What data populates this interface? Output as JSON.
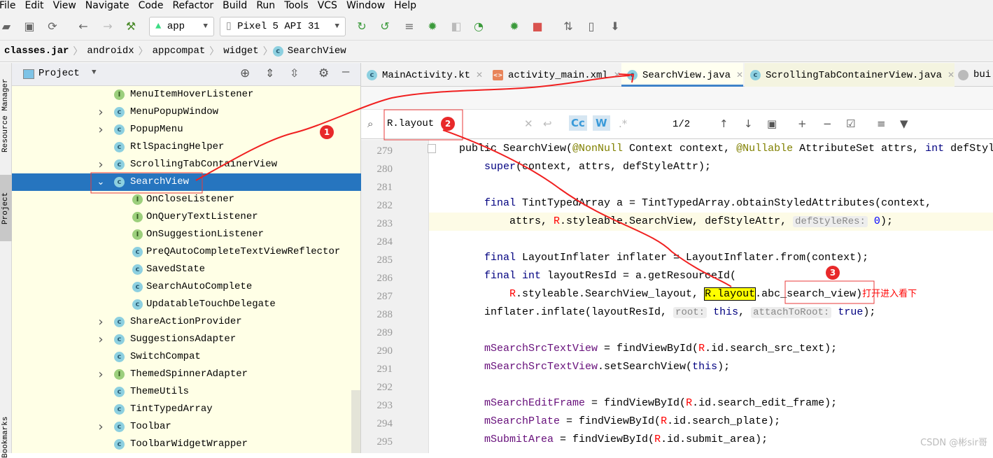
{
  "menu": [
    "File",
    "Edit",
    "View",
    "Navigate",
    "Code",
    "Refactor",
    "Build",
    "Run",
    "Tools",
    "VCS",
    "Window",
    "Help"
  ],
  "toolbar": {
    "config": "app",
    "device": "Pixel 5 API 31"
  },
  "breadcrumb": [
    "classes.jar",
    "androidx",
    "appcompat",
    "widget",
    "SearchView"
  ],
  "side_tabs": [
    "Resource Manager",
    "Project",
    "Bookmarks"
  ],
  "project": {
    "title": "Project",
    "tree": [
      {
        "label": "MenuItemHoverListener",
        "kind": "I",
        "level": 0,
        "chevron": ""
      },
      {
        "label": "MenuPopupWindow",
        "kind": "C",
        "level": 0,
        "chevron": "›"
      },
      {
        "label": "PopupMenu",
        "kind": "C",
        "level": 0,
        "chevron": "›"
      },
      {
        "label": "RtlSpacingHelper",
        "kind": "C",
        "level": 0,
        "chevron": ""
      },
      {
        "label": "ScrollingTabContainerView",
        "kind": "C",
        "level": 0,
        "chevron": "›"
      },
      {
        "label": "SearchView",
        "kind": "C",
        "level": 0,
        "chevron": "⌄",
        "selected": true
      },
      {
        "label": "OnCloseListener",
        "kind": "I",
        "level": 1,
        "chevron": ""
      },
      {
        "label": "OnQueryTextListener",
        "kind": "I",
        "level": 1,
        "chevron": ""
      },
      {
        "label": "OnSuggestionListener",
        "kind": "I",
        "level": 1,
        "chevron": ""
      },
      {
        "label": "PreQAutoCompleteTextViewReflector",
        "kind": "C",
        "level": 1,
        "chevron": ""
      },
      {
        "label": "SavedState",
        "kind": "C",
        "level": 1,
        "chevron": ""
      },
      {
        "label": "SearchAutoComplete",
        "kind": "C",
        "level": 1,
        "chevron": ""
      },
      {
        "label": "UpdatableTouchDelegate",
        "kind": "C",
        "level": 1,
        "chevron": ""
      },
      {
        "label": "ShareActionProvider",
        "kind": "C",
        "level": 0,
        "chevron": "›"
      },
      {
        "label": "SuggestionsAdapter",
        "kind": "C",
        "level": 0,
        "chevron": "›"
      },
      {
        "label": "SwitchCompat",
        "kind": "C",
        "level": 0,
        "chevron": ""
      },
      {
        "label": "ThemedSpinnerAdapter",
        "kind": "I",
        "level": 0,
        "chevron": "›"
      },
      {
        "label": "ThemeUtils",
        "kind": "C",
        "level": 0,
        "chevron": ""
      },
      {
        "label": "TintTypedArray",
        "kind": "C",
        "level": 0,
        "chevron": ""
      },
      {
        "label": "Toolbar",
        "kind": "C",
        "level": 0,
        "chevron": "›"
      },
      {
        "label": "ToolbarWidgetWrapper",
        "kind": "C",
        "level": 0,
        "chevron": ""
      }
    ]
  },
  "tabs": [
    {
      "label": "MainActivity.kt",
      "icon": "kotlin-class-icon"
    },
    {
      "label": "activity_main.xml",
      "icon": "xml-file-icon"
    },
    {
      "label": "SearchView.java",
      "icon": "class-icon",
      "active": true
    },
    {
      "label": "ScrollingTabContainerView.java",
      "icon": "class-icon"
    },
    {
      "label": "bui",
      "icon": "gradle-icon"
    }
  ],
  "find": {
    "query": "R.layout",
    "match_count": "1/2",
    "case_label": "Cc",
    "word_label": "W",
    "regex_label": ".*"
  },
  "code": [
    {
      "n": "279",
      "t": [
        [
          "plain",
          "public SearchView("
        ],
        [
          "ann",
          "@NonNull"
        ],
        [
          "plain",
          " Context context, "
        ],
        [
          "ann",
          "@Nullable"
        ],
        [
          "plain",
          " AttributeSet attrs, "
        ],
        [
          "kw",
          "int"
        ],
        [
          "plain",
          " defStyl"
        ]
      ],
      "indent": 0
    },
    {
      "n": "280",
      "t": [
        [
          "kw",
          "super"
        ],
        [
          "plain",
          "(context, attrs, defStyleAttr);"
        ]
      ],
      "indent": 1
    },
    {
      "n": "281",
      "t": [],
      "indent": 1
    },
    {
      "n": "282",
      "t": [
        [
          "kw",
          "final"
        ],
        [
          "plain",
          " TintTypedArray a = TintTypedArray.obtainStyledAttributes(context,"
        ]
      ],
      "indent": 1
    },
    {
      "n": "283",
      "t": [
        [
          "plain",
          "attrs, "
        ],
        [
          "R",
          "R"
        ],
        [
          "plain",
          ".styleable.SearchView, defStyleAttr, "
        ],
        [
          "hint",
          "defStyleRes:"
        ],
        [
          "num",
          " 0"
        ],
        [
          "plain",
          ");"
        ]
      ],
      "indent": 2,
      "hl": true
    },
    {
      "n": "284",
      "t": [],
      "indent": 1
    },
    {
      "n": "285",
      "t": [
        [
          "kw",
          "final"
        ],
        [
          "plain",
          " LayoutInflater inflater = LayoutInflater.from(context);"
        ]
      ],
      "indent": 1
    },
    {
      "n": "286",
      "t": [
        [
          "kw",
          "final int"
        ],
        [
          "plain",
          " layoutResId = a.getResourceId("
        ]
      ],
      "indent": 1
    },
    {
      "n": "287",
      "t": [
        [
          "R",
          "R"
        ],
        [
          "plain",
          ".styleable.SearchView_layout, "
        ],
        [
          "mark",
          "R.layout"
        ],
        [
          "plain",
          "."
        ],
        [
          "box",
          "abc_search_view"
        ],
        [
          "plain",
          ")"
        ],
        [
          "note",
          "打开进入看下"
        ]
      ],
      "indent": 2
    },
    {
      "n": "288",
      "t": [
        [
          "plain",
          "inflater.inflate(layoutResId, "
        ],
        [
          "hint",
          "root:"
        ],
        [
          "kw",
          " this"
        ],
        [
          "plain",
          ", "
        ],
        [
          "hint",
          "attachToRoot:"
        ],
        [
          "kw",
          " true"
        ],
        [
          "plain",
          ");"
        ]
      ],
      "indent": 1
    },
    {
      "n": "289",
      "t": [],
      "indent": 1
    },
    {
      "n": "290",
      "t": [
        [
          "fld",
          "mSearchSrcTextView"
        ],
        [
          "plain",
          " = findViewById("
        ],
        [
          "R",
          "R"
        ],
        [
          "plain",
          ".id.search_src_text);"
        ]
      ],
      "indent": 1
    },
    {
      "n": "291",
      "t": [
        [
          "fld",
          "mSearchSrcTextView"
        ],
        [
          "plain",
          ".setSearchView("
        ],
        [
          "kw",
          "this"
        ],
        [
          "plain",
          ");"
        ]
      ],
      "indent": 1
    },
    {
      "n": "292",
      "t": [],
      "indent": 1
    },
    {
      "n": "293",
      "t": [
        [
          "fld",
          "mSearchEditFrame"
        ],
        [
          "plain",
          " = findViewById("
        ],
        [
          "R",
          "R"
        ],
        [
          "plain",
          ".id.search_edit_frame);"
        ]
      ],
      "indent": 1
    },
    {
      "n": "294",
      "t": [
        [
          "fld",
          "mSearchPlate"
        ],
        [
          "plain",
          " = findViewById("
        ],
        [
          "R",
          "R"
        ],
        [
          "plain",
          ".id.search_plate);"
        ]
      ],
      "indent": 1
    },
    {
      "n": "295",
      "t": [
        [
          "fld",
          "mSubmitArea"
        ],
        [
          "plain",
          " = findViewById("
        ],
        [
          "R",
          "R"
        ],
        [
          "plain",
          ".id.submit_area);"
        ]
      ],
      "indent": 1
    }
  ],
  "annotations": {
    "step1": "1",
    "step2": "2",
    "step3": "3",
    "color": "#e8292a"
  },
  "watermark": "CSDN @彬sir哥"
}
